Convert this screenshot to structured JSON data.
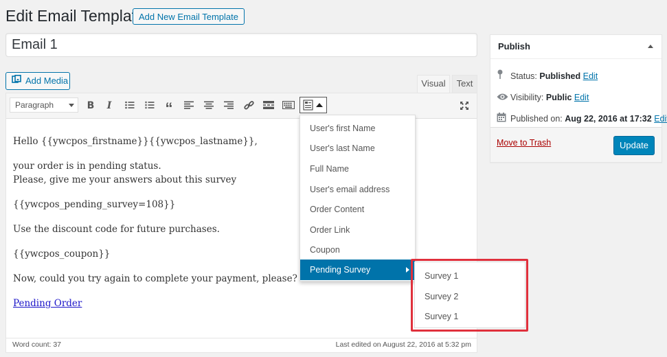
{
  "header": {
    "title": "Edit Email Template",
    "add_new_label": "Add New Email Template"
  },
  "post_title": "Email 1",
  "editor": {
    "add_media_label": "Add Media",
    "tabs": {
      "visual": "Visual",
      "text": "Text"
    },
    "format_select": "Paragraph",
    "toolbar_icons": [
      "bold-icon",
      "italic-icon",
      "bullet-list-icon",
      "numbered-list-icon",
      "blockquote-icon",
      "align-left-icon",
      "align-center-icon",
      "align-right-icon",
      "link-icon",
      "read-more-icon",
      "toolbar-toggle-icon",
      "placeholder-dropdown-icon",
      "fullscreen-icon"
    ],
    "toolbar_glyphs": {
      "bold": "B",
      "italic": "I",
      "blockquote": "“"
    },
    "content": {
      "greeting": "Hello {{ywcpos_firstname}}{{ywcpos_lastname}},",
      "line1": "your order is in pending status.",
      "line2": "Please, give me your answers about this survey",
      "survey_tag": "{{ywcpos_pending_survey=108}}",
      "discount": "Use the discount code for future purchases.",
      "coupon_tag": "{{ywcpos_coupon}}",
      "retry": "Now, could you try again to complete your payment, please?",
      "link": "Pending Order"
    },
    "word_count": "Word count: 37",
    "last_edited": "Last edited on August 22, 2016 at 5:32 pm"
  },
  "placeholder_menu": {
    "items": [
      "User's first Name",
      "User's last Name",
      "Full Name",
      "User's email address",
      "Order Content",
      "Order Link",
      "Coupon",
      "Pending Survey"
    ],
    "highlighted": "Pending Survey",
    "submenu": [
      "Survey 1",
      "Survey 2",
      "Survey 1"
    ]
  },
  "publish": {
    "title": "Publish",
    "status_label": "Status:",
    "status_value": "Published",
    "visibility_label": "Visibility:",
    "visibility_value": "Public",
    "published_label": "Published on:",
    "published_value": "Aug 22, 2016 at 17:32",
    "edit_label": "Edit",
    "trash_label": "Move to Trash",
    "update_label": "Update"
  },
  "colors": {
    "accent": "#0073aa",
    "primary_button": "#0085ba",
    "highlight_border": "#e0303c",
    "trash": "#a00"
  }
}
